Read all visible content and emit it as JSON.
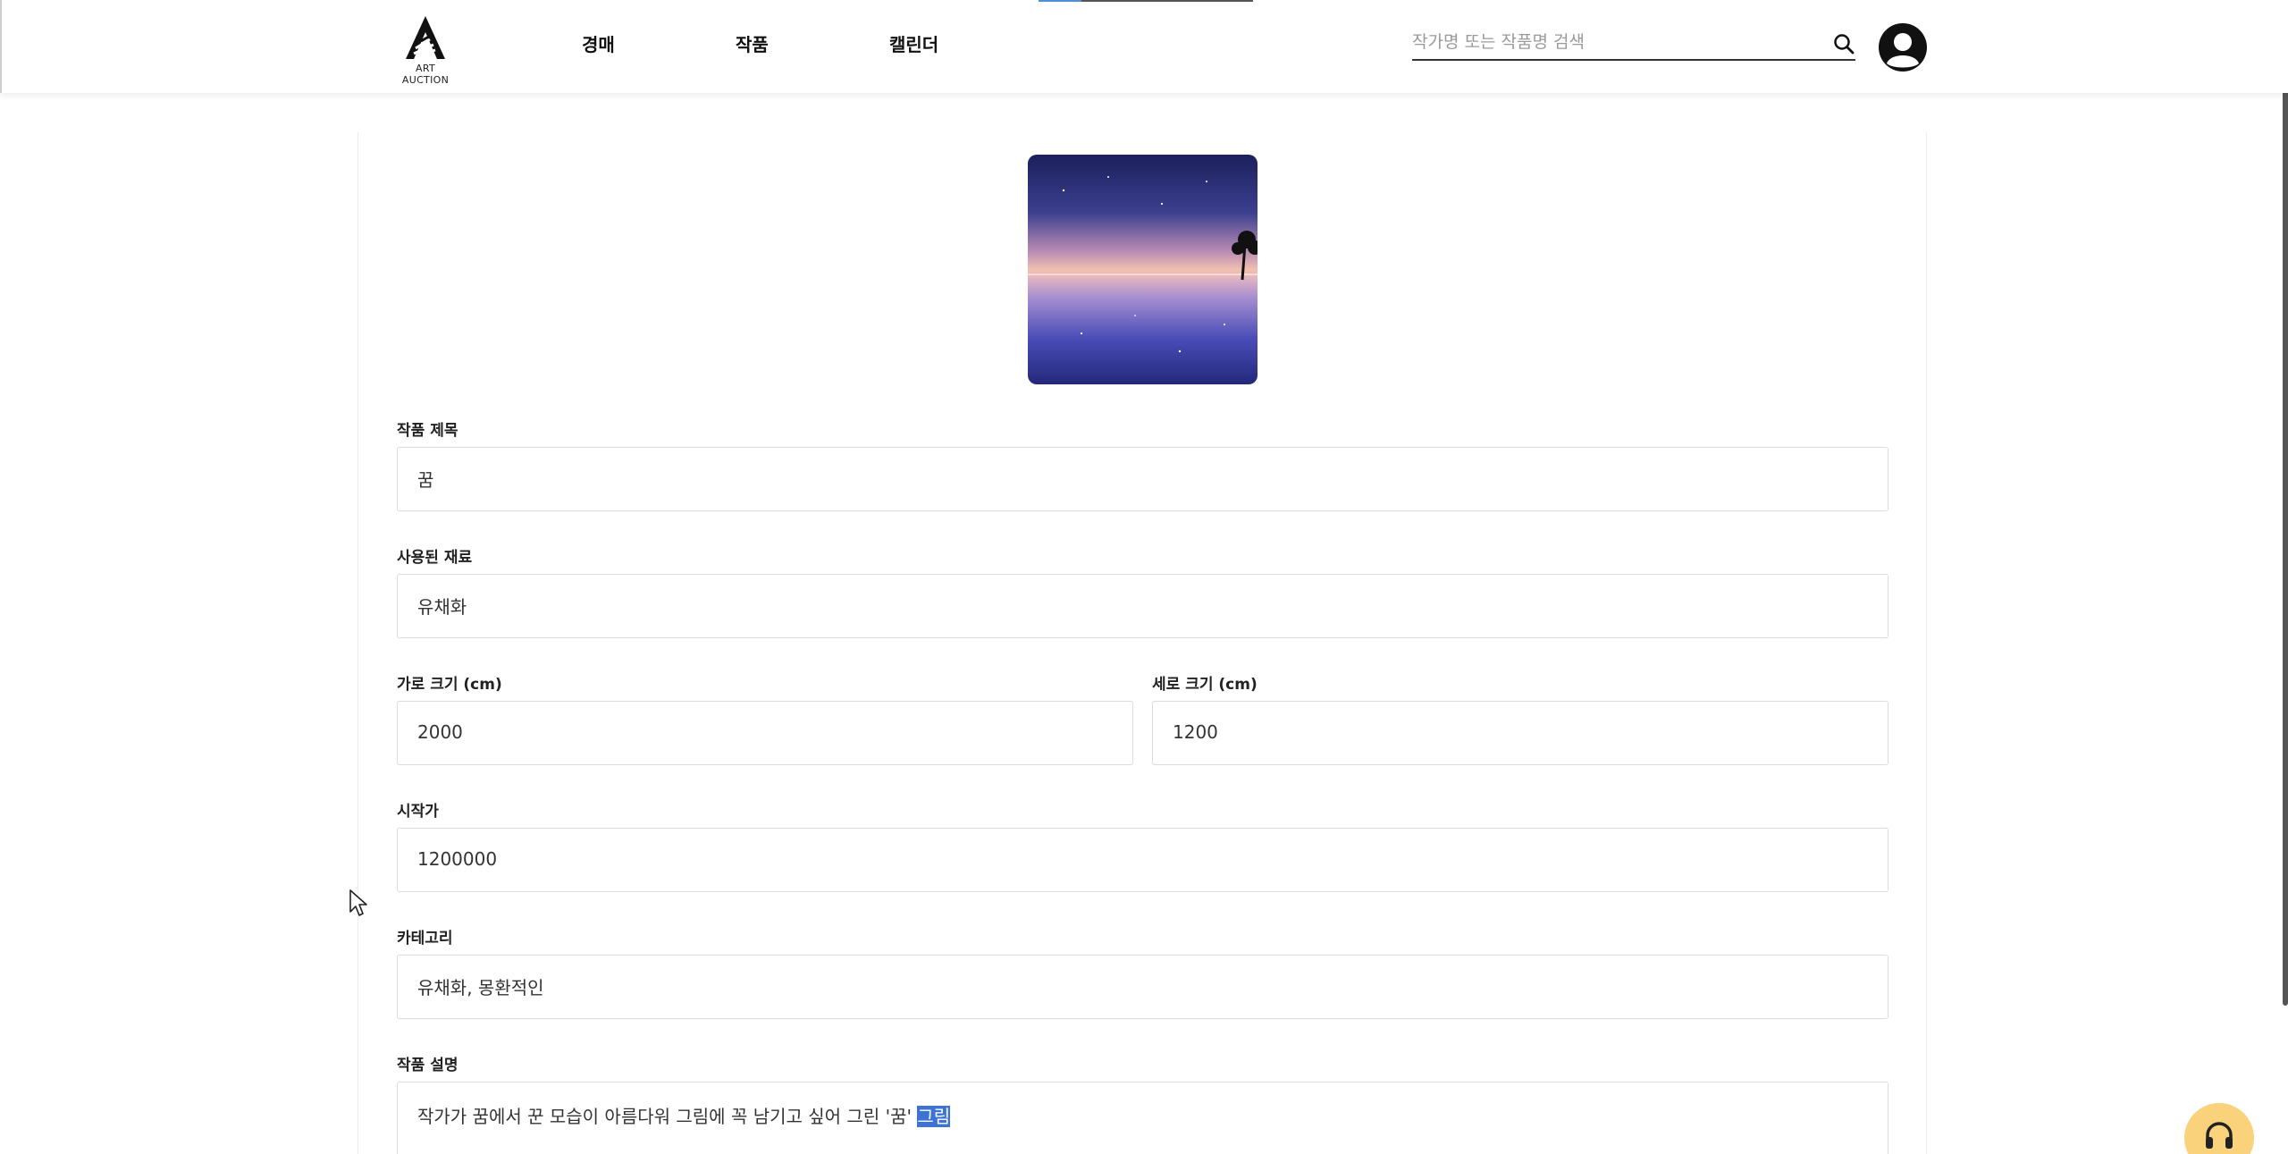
{
  "header": {
    "logo_text": "ART AUCTION",
    "nav": [
      {
        "label": "경매"
      },
      {
        "label": "작품"
      },
      {
        "label": "캘린더"
      }
    ],
    "search": {
      "placeholder": "작가명 또는 작품명 검색",
      "value": ""
    },
    "icons": {
      "search": "search-icon",
      "profile": "user-avatar-icon"
    }
  },
  "artwork": {
    "image": "night-lake-painting"
  },
  "form": {
    "title": {
      "label": "작품 제목",
      "value": "꿈"
    },
    "material": {
      "label": "사용된 재료",
      "value": "유채화"
    },
    "width": {
      "label": "가로 크기 (cm)",
      "value": "2000"
    },
    "height": {
      "label": "세로 크기 (cm)",
      "value": "1200"
    },
    "start_price": {
      "label": "시작가",
      "value": "1200000"
    },
    "category": {
      "label": "카테고리",
      "value": "유채화, 몽환적인"
    },
    "description": {
      "label": "작품 설명",
      "value_before": "작가가 꿈에서 꾼 모습이 아름다워 그림에 꼭 남기고 싶어 그린 '꿈' ",
      "value_selected": "그림"
    }
  },
  "colors": {
    "accent": "#4f8fd6",
    "selection": "#3d73d6",
    "support_button": "#f9d27b"
  }
}
